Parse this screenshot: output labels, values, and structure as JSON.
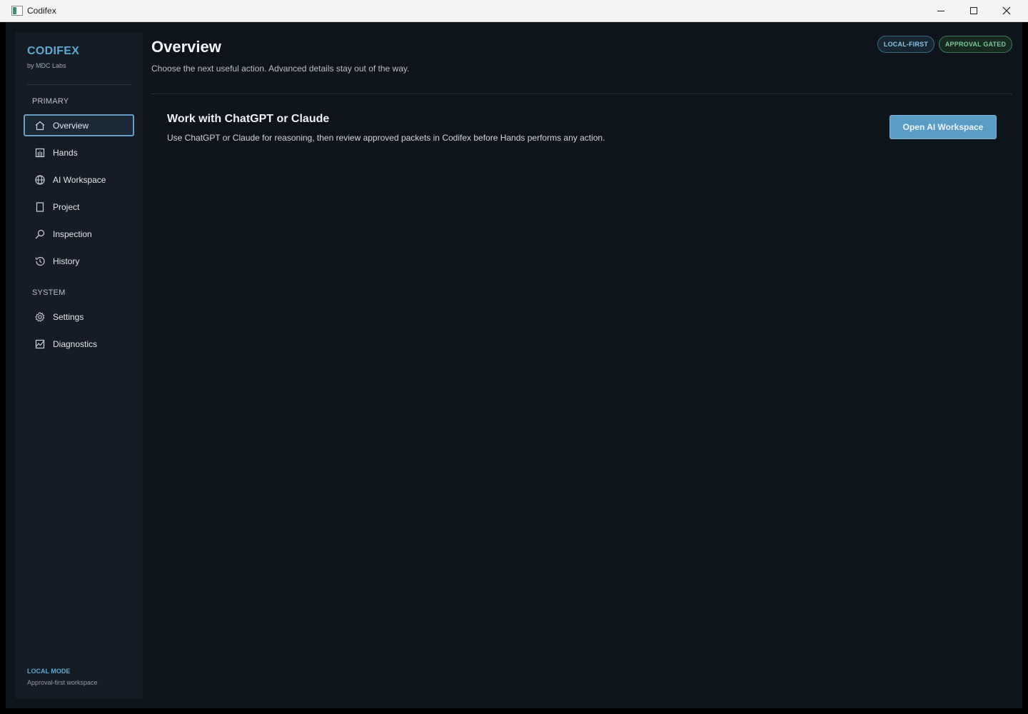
{
  "window": {
    "title": "Codifex"
  },
  "brand": {
    "name": "CODIFEX",
    "subtitle": "by MDC Labs"
  },
  "sidebar": {
    "primary_label": "PRIMARY",
    "primary_items": [
      {
        "label": "Overview",
        "icon": "home-icon",
        "active": true
      },
      {
        "label": "Hands",
        "icon": "hands-icon"
      },
      {
        "label": "AI Workspace",
        "icon": "globe-icon"
      },
      {
        "label": "Project",
        "icon": "document-icon"
      },
      {
        "label": "Inspection",
        "icon": "search-icon"
      },
      {
        "label": "History",
        "icon": "history-icon"
      }
    ],
    "system_label": "SYSTEM",
    "system_items": [
      {
        "label": "Settings",
        "icon": "gear-icon"
      },
      {
        "label": "Diagnostics",
        "icon": "diagnostics-icon"
      }
    ],
    "footer": {
      "mode": "LOCAL MODE",
      "description": "Approval-first workspace"
    }
  },
  "header": {
    "title": "Overview",
    "subtitle": "Choose the next useful action. Advanced details stay out of the way.",
    "badges": [
      "LOCAL-FIRST",
      "APPROVAL GATED"
    ]
  },
  "card": {
    "title": "Work with ChatGPT or Claude",
    "description": "Use ChatGPT or Claude for reasoning, then review approved packets in Codifex before Hands performs any action.",
    "button_label": "Open AI Workspace"
  },
  "colors": {
    "accent": "#5fa8d3",
    "button": "#5a9cc4",
    "badge_local": "#8ec6e6",
    "badge_approval": "#7bc796",
    "background": "#0e141b",
    "sidebar": "#141d26"
  }
}
